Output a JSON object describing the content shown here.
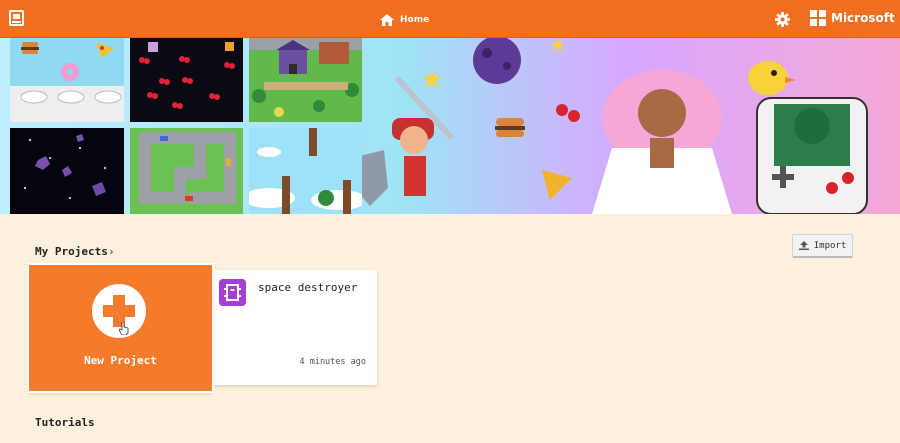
{
  "header": {
    "home_label": "Home",
    "brand_label": "Microsoft",
    "accent_color": "#f26f22"
  },
  "my_projects": {
    "title": "My Projects",
    "chevron": "›",
    "import_label": "Import",
    "new_project_label": "New Project",
    "projects": [
      {
        "name": "space destroyer",
        "modified": "4 minutes ago",
        "icon": "arcade-icon"
      }
    ]
  },
  "tutorials": {
    "title": "Tutorials"
  },
  "icons": [
    "arcade-logo-icon",
    "home-icon",
    "gear-icon",
    "microsoft-logo-icon",
    "upload-icon",
    "plus-icon",
    "pointer-cursor-icon"
  ]
}
